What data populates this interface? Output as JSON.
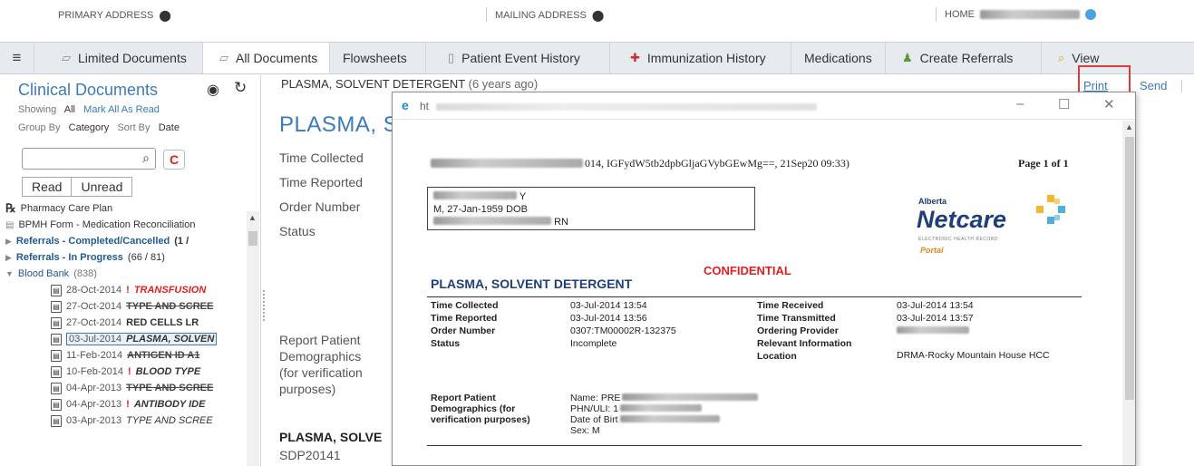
{
  "header": {
    "primary_address_label": "PRIMARY ADDRESS",
    "mailing_address_label": "MAILING ADDRESS",
    "home_label": "HOME"
  },
  "tabs": [
    {
      "label": "Limited Documents",
      "icon": "document-icon"
    },
    {
      "label": "All Documents",
      "icon": "document-icon",
      "active": true
    },
    {
      "label": "Flowsheets"
    },
    {
      "label": "Patient Event History",
      "icon": "clipboard-icon"
    },
    {
      "label": "Immunization History",
      "icon": "syringe-icon"
    },
    {
      "label": "Medications"
    },
    {
      "label": "Create Referrals",
      "icon": "people-icon"
    },
    {
      "label": "View",
      "icon": "search-icon"
    }
  ],
  "left": {
    "title": "Clinical Documents",
    "showing_label": "Showing",
    "showing_value": "All",
    "mark_all_read": "Mark All As Read",
    "group_by_label": "Group By",
    "group_by_value": "Category",
    "sort_by_label": "Sort By",
    "sort_by_value": "Date",
    "clear_button": "C",
    "read_button": "Read",
    "unread_button": "Unread",
    "tree": {
      "pharmacy": "Pharmacy Care Plan",
      "bpmh": "BPMH Form - Medication Reconciliation",
      "ref_completed": "Referrals - Completed/Cancelled",
      "ref_completed_count": "(1 /",
      "ref_progress": "Referrals - In Progress",
      "ref_progress_count": "(66 / 81)",
      "blood_bank": "Blood Bank",
      "blood_bank_count": "(838)",
      "items": [
        {
          "date": "28-Oct-2014",
          "flag": "!",
          "name": "TRANSFUSION",
          "style": "italic-red"
        },
        {
          "date": "27-Oct-2014",
          "flag": "",
          "name": "TYPE AND SCREE",
          "style": "strike"
        },
        {
          "date": "27-Oct-2014",
          "flag": "",
          "name": "RED CELLS LR",
          "style": "bold"
        },
        {
          "date": "03-Jul-2014",
          "flag": "",
          "name": "PLASMA, SOLVEN",
          "style": "italic-sel"
        },
        {
          "date": "11-Feb-2014",
          "flag": "",
          "name": "ANTIGEN ID A1",
          "style": "strike"
        },
        {
          "date": "10-Feb-2014",
          "flag": "!",
          "name": "BLOOD TYPE",
          "style": "italic"
        },
        {
          "date": "04-Apr-2013",
          "flag": "",
          "name": "TYPE AND SCREE",
          "style": "strike"
        },
        {
          "date": "04-Apr-2013",
          "flag": "!",
          "name": "ANTIBODY IDE",
          "style": "italic"
        },
        {
          "date": "03-Apr-2013",
          "flag": "",
          "name": "TYPE AND SCREE",
          "style": "italic"
        }
      ]
    }
  },
  "main": {
    "doc_header": "PLASMA, SOLVENT DETERGENT",
    "doc_ago": "(6 years ago)",
    "print_link": "Print",
    "send_link": "Send",
    "big_title": "PLASMA, S",
    "labels": [
      "Time Collected",
      "Time Reported",
      "Order Number",
      "Status"
    ],
    "report_label": "Report Patient Demographics (for verification purposes)",
    "bottom_title": "PLASMA, SOLVE",
    "bottom_code": "SDP20141"
  },
  "popup": {
    "title_prefix": "ht",
    "audit_line": "014, IGFydW5tb2dpbGljaGVybGEwMg==, 21Sep20 09:33)",
    "page_of": "Page 1 of 1",
    "patient_line1": "Y",
    "patient_line2": "M, 27-Jan-1959 DOB",
    "patient_line3": "RN",
    "netcare_alberta": "Alberta",
    "netcare_name": "Netcare",
    "netcare_ehr": "ELECTRONIC HEALTH RECORD",
    "netcare_portal": "Portal",
    "confidential": "CONFIDENTIAL",
    "test_name": "PLASMA, SOLVENT DETERGENT",
    "fields": {
      "time_collected_label": "Time Collected",
      "time_collected": "03-Jul-2014 13:54",
      "time_reported_label": "Time Reported",
      "time_reported": "03-Jul-2014 13:56",
      "order_number_label": "Order Number",
      "order_number": "0307:TM00002R-132375",
      "status_label": "Status",
      "status": "Incomplete",
      "time_received_label": "Time Received",
      "time_received": "03-Jul-2014 13:54",
      "time_transmitted_label": "Time Transmitted",
      "time_transmitted": "03-Jul-2014 13:57",
      "ordering_provider_label": "Ordering Provider",
      "relevant_info_label": "Relevant Information",
      "location_label": "Location",
      "location": "DRMA-Rocky Mountain House HCC",
      "report_label_1": "Report Patient",
      "report_label_2": "Demographics (for",
      "report_label_3": "verification purposes)",
      "name_label": "Name: PRE",
      "phn_label": "PHN/ULI: 1",
      "dob_label": "Date of Birt",
      "sex_label": "Sex: M"
    }
  },
  "colors": {
    "link_blue": "#3a7bb8",
    "alert_red": "#e02020",
    "netcare_navy": "#1f3f7a",
    "portal_orange": "#e08a20"
  }
}
